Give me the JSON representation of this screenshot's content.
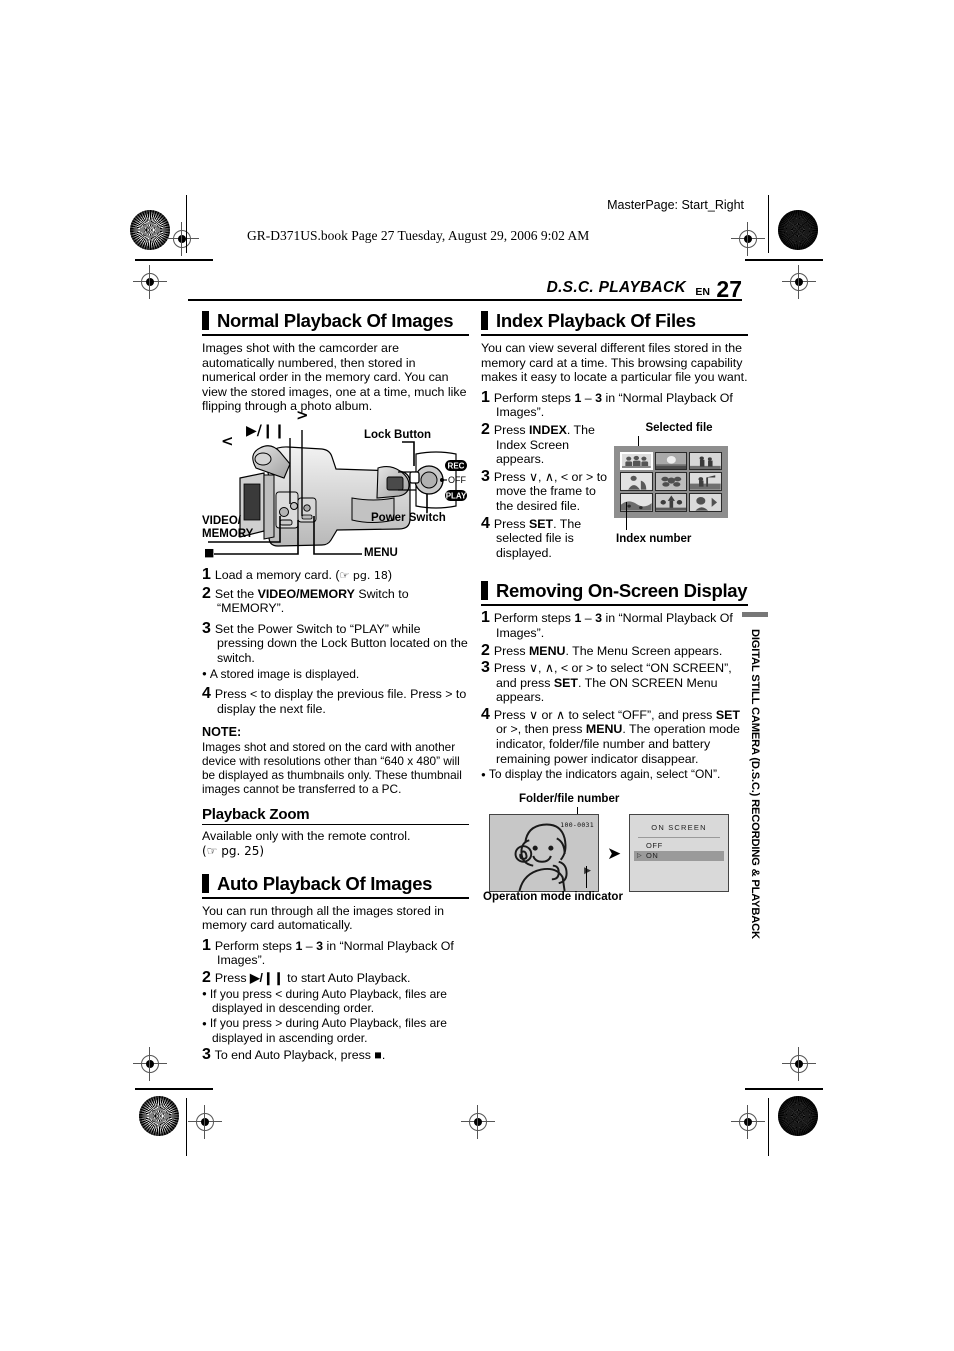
{
  "header": {
    "masterpage": "MasterPage: Start_Right",
    "bookline": "GR-D371US.book  Page 27  Tuesday, August 29, 2006  9:02 AM",
    "chapter": "D.S.C. PLAYBACK",
    "en_label": "EN",
    "page_number": "27"
  },
  "side_tab": {
    "label": "DIGITAL STILL CAMERA (D.S.C.) RECORDING & PLAYBACK"
  },
  "left_column": {
    "section1": {
      "heading": "Normal Playback Of Images",
      "intro": "Images shot with the camcorder are automatically numbered, then stored in numerical order in the memory card. You can view the stored images, one at a time, much like flipping through a photo album.",
      "figure": {
        "label_play_pause": "▶/❙❙",
        "label_prev": "<",
        "label_next": ">",
        "label_lock_button": "Lock Button",
        "label_power_switch": "Power Switch",
        "label_video_memory": "VIDEO/\nMEMORY",
        "label_stop": "■",
        "label_menu": "MENU",
        "switch_rec": "REC",
        "switch_off": "OFF",
        "switch_play": "PLAY"
      },
      "steps": [
        {
          "num": "1",
          "text": "Load a memory card. (",
          "ref": "☞ pg. 18",
          "text_after": ")"
        },
        {
          "num": "2",
          "pre": "Set the ",
          "bold": "VIDEO/MEMORY",
          "post": " Switch to “MEMORY”."
        },
        {
          "num": "3",
          "text": "Set the Power Switch to “PLAY” while pressing down the Lock Button located on the switch.",
          "bullet": "A stored image is displayed."
        },
        {
          "num": "4",
          "text": "Press < to display the previous file. Press > to display the next file."
        }
      ],
      "note_heading": "NOTE:",
      "note_text": "Images shot and stored on the card with another device with resolutions other than “640 x 480” will be displayed as thumbnails only. These thumbnail images cannot be transferred to a PC.",
      "subsection": {
        "heading": "Playback Zoom",
        "text": "Available only with the remote control.",
        "ref": "(☞ pg. 25)"
      }
    },
    "section2": {
      "heading": "Auto Playback Of Images",
      "intro": "You can run through all the images stored in memory card automatically.",
      "steps": [
        {
          "num": "1",
          "pre": "Perform steps ",
          "bold1": "1",
          "mid": " – ",
          "bold2": "3",
          "post": " in “Normal Playback Of Images”."
        },
        {
          "num": "2",
          "pre": "Press ",
          "bold": "▶/❙❙",
          "post": " to start Auto Playback.",
          "bullets": [
            "If you press < during Auto Playback, files are displayed in descending order.",
            "If you press > during Auto Playback, files are displayed in ascending order."
          ]
        },
        {
          "num": "3",
          "text": "To end Auto Playback, press ■."
        }
      ]
    }
  },
  "right_column": {
    "section1": {
      "heading": "Index Playback Of Files",
      "intro": "You can view several different files stored in the memory card at a time. This browsing capability makes it easy to locate a particular file you want.",
      "steps": [
        {
          "num": "1",
          "pre": "Perform steps ",
          "bold1": "1",
          "mid": " – ",
          "bold2": "3",
          "post": " in “Normal Playback Of Images”."
        },
        {
          "num": "2",
          "pre": "Press ",
          "bold": "INDEX",
          "post": ". The Index Screen appears."
        },
        {
          "num": "3",
          "text": "Press ∨, ∧,  < or > to move the frame to the desired file."
        },
        {
          "num": "4",
          "pre": "Press ",
          "bold": "SET",
          "post": ". The selected file is displayed."
        }
      ],
      "figure": {
        "caption_top": "Selected file",
        "caption_bottom": "Index number",
        "thumb_count": 9,
        "selected_index": 1
      }
    },
    "section2": {
      "heading": "Removing On-Screen Display",
      "steps": [
        {
          "num": "1",
          "pre": "Perform steps ",
          "bold1": "1",
          "mid": " – ",
          "bold2": "3",
          "post": " in “Normal Playback Of Images”."
        },
        {
          "num": "2",
          "pre": "Press ",
          "bold": "MENU",
          "post": ". The Menu Screen appears."
        },
        {
          "num": "3",
          "pre": "Press ∨, ∧, < or > to select “ON SCREEN”, and press ",
          "bold": "SET",
          "post": ". The ON SCREEN Menu appears."
        },
        {
          "num": "4",
          "pre": "Press ∨ or ∧ to select “OFF”, and press ",
          "bold": "SET",
          "mid": " or >, then press ",
          "bold2": "MENU",
          "post": ". The operation mode indicator, folder/file number and battery remaining power indicator disappear.",
          "bullet": "To display the indicators again, select “ON”."
        }
      ],
      "figure": {
        "caption_top": "Folder/file number",
        "caption_bottom": "Operation mode indicator",
        "lcd_file_number": "100-0031",
        "lcd_opmode_icon": "▶",
        "menu_title": "ON SCREEN",
        "menu_items": [
          "OFF",
          "ON"
        ],
        "menu_selected": "ON"
      }
    }
  }
}
